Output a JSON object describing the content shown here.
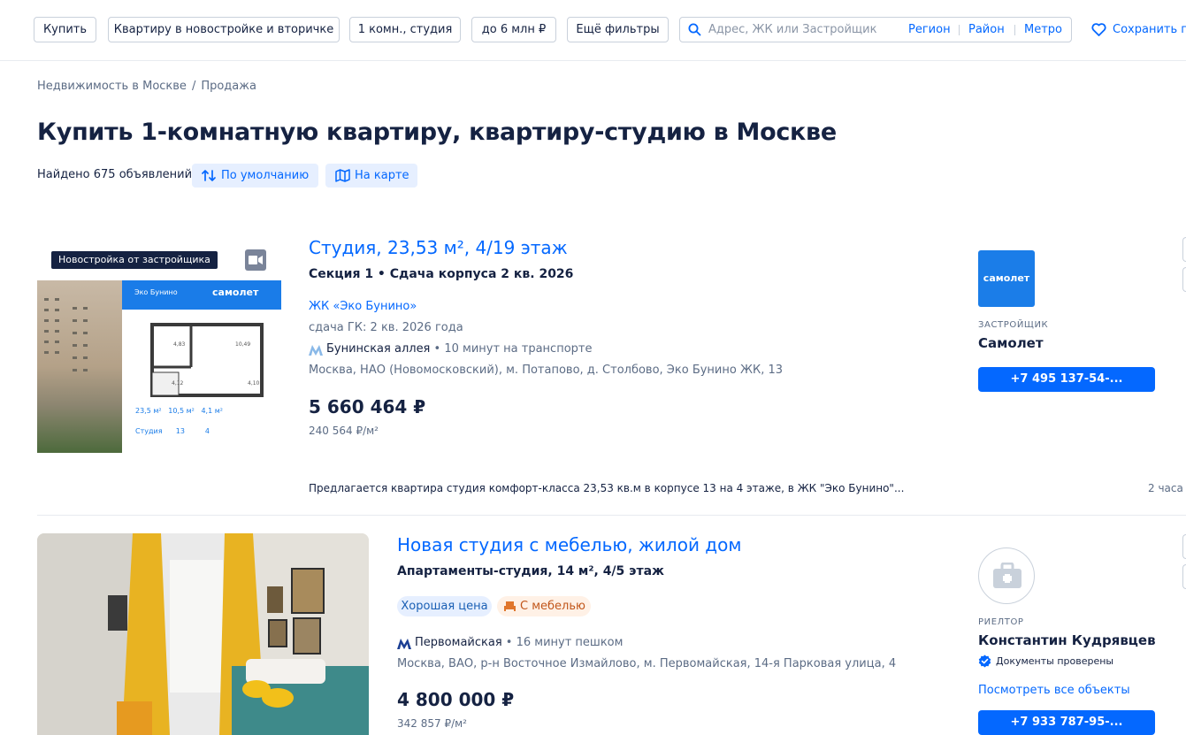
{
  "filters": {
    "buy": "Купить",
    "property_type": "Квартиру в новостройке и вторичке",
    "rooms": "1 комн., студия",
    "price": "до 6 млн ₽",
    "more": "Ещё фильтры",
    "search_placeholder": "Адрес, ЖК или Застройщик",
    "region": "Регион",
    "district": "Район",
    "metro": "Метро",
    "save_search": "Сохранить по"
  },
  "breadcrumb": [
    "Недвижимость в Москве",
    "Продажа"
  ],
  "page_title": "Купить 1-комнатную квартиру, квартиру-студию в Москве",
  "results": {
    "found": "Найдено 675 объявлений",
    "sort_label": "По умолчанию",
    "map_label": "На карте"
  },
  "listings": [
    {
      "badge": "Новостройка от застройщика",
      "image": {
        "eco_label": "Эко Бунино",
        "brand": "самолет",
        "stats_line1": "23,5 м²   10,5 м²   4,1 м²",
        "stats_line2": "Студия      13         4"
      },
      "title": "Студия, 23,53 м², 4/19 этаж",
      "subtitle": "Секция 1 • Сдача корпуса 2 кв. 2026",
      "complex": "ЖК «Эко Бунино»",
      "delivery": "сдача ГК: 2 кв. 2026 года",
      "metro_station": "Бунинская аллея",
      "metro_time": "• 10 минут на транспорте",
      "metro_color": "#8ab9e8",
      "address": "Москва, НАО (Новомосковский), м. Потапово, д. Столбово, Эко Бунино ЖК, 13",
      "price": "5 660 464 ₽",
      "price_per_m": "240 564 ₽/м²",
      "description": "Предлагается квартира студия комфорт-класса 23,53 кв.м в корпусе 13 на 4 этаже, в ЖК \"Эко Бунино\"...",
      "time": "2 часа",
      "agent": {
        "logo_text": "самолет",
        "role": "ЗАСТРОЙЩИК",
        "name": "Самолет",
        "phone": "+7 495 137-54-..."
      }
    },
    {
      "title": "Новая студия с мебелью, жилой дом",
      "subtitle": "Апартаменты-студия, 14 м², 4/5 этаж",
      "tags": [
        "Хорошая цена",
        "С мебелью"
      ],
      "metro_station": "Первомайская",
      "metro_time": "• 16 минут пешком",
      "metro_color": "#1c3f94",
      "address": "Москва, ВАО, р-н Восточное Измайлово, м. Первомайская, 14-я Парковая улица, 4",
      "price": "4 800 000 ₽",
      "price_per_m": "342 857 ₽/м²",
      "agent": {
        "role": "РИЕЛТОР",
        "name": "Константин Кудрявцев",
        "verified": "Документы проверены",
        "all_objects": "Посмотреть все объекты",
        "phone": "+7 933 787-95-..."
      }
    }
  ],
  "colors": {
    "accent": "#0468ff",
    "text": "#152242",
    "muted": "#5c6c85"
  }
}
